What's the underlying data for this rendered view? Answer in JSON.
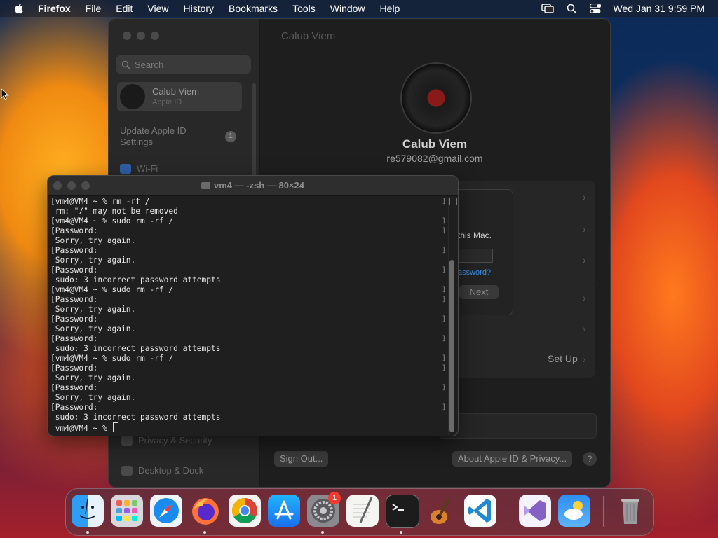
{
  "menubar": {
    "app_name": "Firefox",
    "items": [
      "File",
      "Edit",
      "View",
      "History",
      "Bookmarks",
      "Tools",
      "Window",
      "Help"
    ],
    "clock": "Wed Jan 31  9:59 PM"
  },
  "settings": {
    "search_placeholder": "Search",
    "profile_name": "Calub Viem",
    "profile_sub": "Apple ID",
    "update_label": "Update Apple ID Settings",
    "update_badge": "1",
    "wifi_label": "Wi-Fi",
    "privacy_label": "Privacy & Security",
    "desktop_label": "Desktop & Dock",
    "window_title": "Calub Viem",
    "user_name": "Calub Viem",
    "user_email": "re579082@gmail.com",
    "setup_label": "Set Up",
    "signout_label": "Sign Out...",
    "about_label": "About Apple ID & Privacy...",
    "help_label": "?"
  },
  "dialog": {
    "message": "this Mac.",
    "forgot": "assword?",
    "next_label": "Next"
  },
  "terminal": {
    "title": "vm4 — -zsh — 80×24",
    "lines": [
      "[vm4@VM4 ~ % rm -rf /",
      " rm: \"/\" may not be removed",
      "[vm4@VM4 ~ % sudo rm -rf /",
      "[Password:",
      " Sorry, try again.",
      "[Password:",
      " Sorry, try again.",
      "[Password:",
      " sudo: 3 incorrect password attempts",
      "[vm4@VM4 ~ % sudo rm -rf /",
      "[Password:",
      " Sorry, try again.",
      "[Password:",
      " Sorry, try again.",
      "[Password:",
      " sudo: 3 incorrect password attempts",
      "[vm4@VM4 ~ % sudo rm -rf /",
      "[Password:",
      " Sorry, try again.",
      "[Password:",
      " Sorry, try again.",
      "[Password:",
      " sudo: 3 incorrect password attempts"
    ],
    "prompt": " vm4@VM4 ~ % "
  },
  "dock": {
    "apps": [
      "finder",
      "launchpad",
      "safari",
      "firefox",
      "chrome",
      "app-store",
      "system-settings",
      "textedit",
      "terminal",
      "garageband",
      "vscode",
      "visual-studio",
      "weather",
      "trash"
    ],
    "settings_badge": "1"
  },
  "colors": {
    "accent": "#3a8ee6",
    "badge": "#f23a2f"
  }
}
